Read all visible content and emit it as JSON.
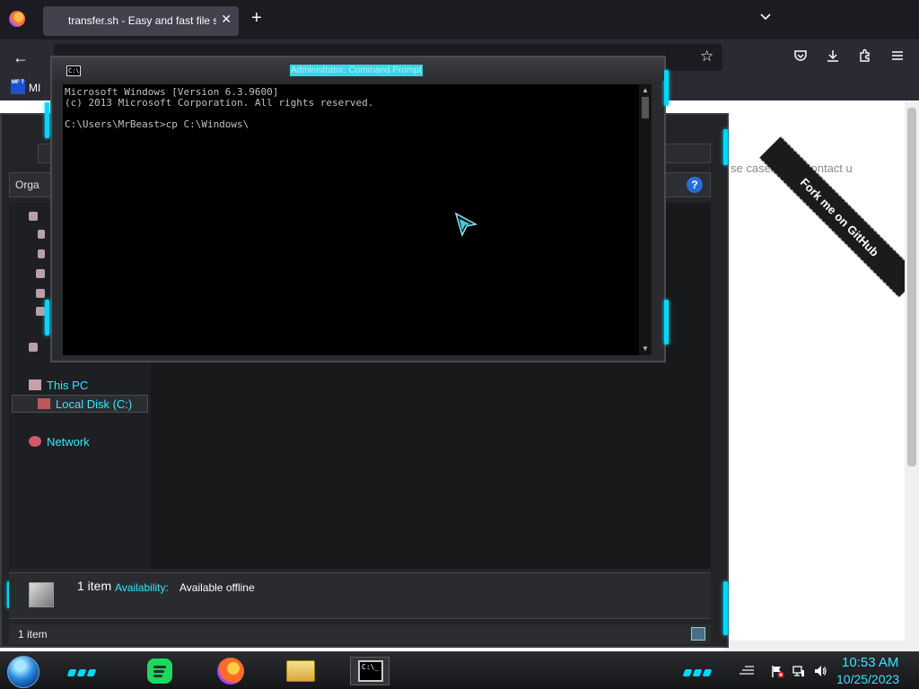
{
  "browser": {
    "tab_title": "transfer.sh - Easy and fast file sh",
    "tab_close": "✕",
    "new_tab": "+",
    "bookmark": {
      "favicon_text": "MF T",
      "label": "MI"
    }
  },
  "web": {
    "nav_use_cases": "se cases",
    "nav_contact": "contact u",
    "ribbon": "Fork me on GitHub"
  },
  "explorer": {
    "organize_label": "Orga",
    "help_label": "?",
    "nav": {
      "this_pc": "This PC",
      "local_disk": "Local Disk (C:)",
      "network": "Network"
    },
    "details": {
      "count": "1 item",
      "availability_label": "Availability:",
      "availability_value": "Available offline"
    },
    "status_text": "1 item"
  },
  "cmd": {
    "title": "Administrator: Command Prompt",
    "icon_text": "C:\\",
    "lines": [
      "Microsoft Windows [Version 6.3.9600]",
      "(c) 2013 Microsoft Corporation. All rights reserved.",
      "",
      "C:\\Users\\MrBeast>cp C:\\Windows\\"
    ]
  },
  "taskbar": {
    "clock_time": "10:53 AM",
    "clock_date": "10/25/2023",
    "cmd_icon_text": "C:\\_"
  },
  "colors": {
    "accent": "#00d8ff",
    "accent_text": "#38e6ff",
    "console_bg": "#000000",
    "console_text": "#c0c0c0"
  }
}
